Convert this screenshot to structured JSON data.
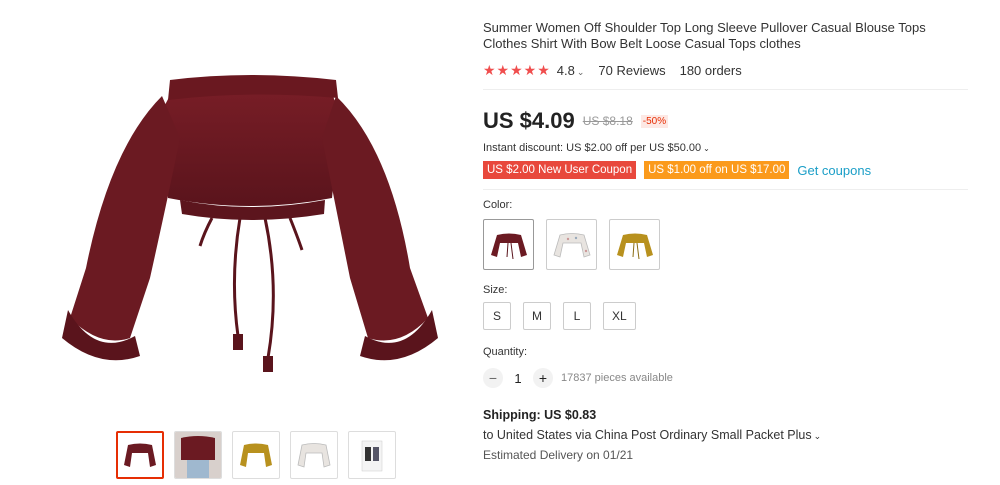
{
  "product": {
    "title": "Summer Women Off Shoulder Top Long Sleeve Pullover Casual Blouse Tops Clothes Shirt With Bow Belt Loose Casual Tops clothes",
    "stars": "★★★★★",
    "rating": "4.8",
    "reviews": "70 Reviews",
    "orders": "180 orders"
  },
  "price": {
    "current": "US $4.09",
    "original": "US $8.18",
    "discount": "-50%"
  },
  "discount": {
    "instant": "Instant discount: US $2.00 off per US $50.00",
    "coupon_new_user": "US $2.00 New User Coupon",
    "coupon_off": "US $1.00 off on US $17.00",
    "get_coupons": "Get coupons"
  },
  "options": {
    "color_label": "Color:",
    "colors": [
      {
        "name": "wine-red",
        "hex": "#6b1a22"
      },
      {
        "name": "white-floral",
        "hex": "#e8e4e0"
      },
      {
        "name": "mustard-yellow",
        "hex": "#b8911e"
      }
    ],
    "size_label": "Size:",
    "sizes": [
      "S",
      "M",
      "L",
      "XL"
    ]
  },
  "quantity": {
    "label": "Quantity:",
    "value": "1",
    "available": "17837 pieces available",
    "minus": "−",
    "plus": "+"
  },
  "shipping": {
    "title": "Shipping: US $0.83",
    "to": "to United States via China Post Ordinary Small Packet Plus",
    "estimated": "Estimated Delivery on 01/21"
  },
  "colors": {
    "accent_red": "#e62e04",
    "coupon_red": "#e8483c",
    "coupon_orange": "#fb9a1b",
    "link_blue": "#1a9ec7",
    "star_red": "#f04e4e"
  }
}
